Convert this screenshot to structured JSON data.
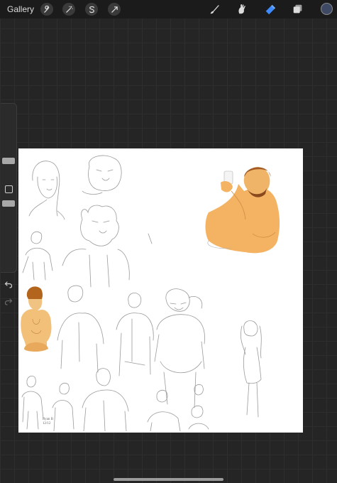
{
  "topbar": {
    "gallery_label": "Gallery",
    "actions": [
      "wrench-icon",
      "magic-wand-icon",
      "selection-icon",
      "transform-icon"
    ],
    "tools": [
      "brush-icon",
      "smudge-icon",
      "eraser-icon",
      "layers-icon"
    ],
    "active_tool": "eraser-icon",
    "active_color": "#3e4a63"
  },
  "sidebar": {
    "brush_size_level": 0.55,
    "opacity_level": 0.4
  },
  "canvas": {
    "background": "#ffffff",
    "signature_line1": "Ryan B",
    "signature_line2": "12/12"
  },
  "colors": {
    "toolbar_bg": "#1b1b1b",
    "accent": "#3d8bff",
    "skin": "#f3b363",
    "hair": "#b3651e"
  }
}
